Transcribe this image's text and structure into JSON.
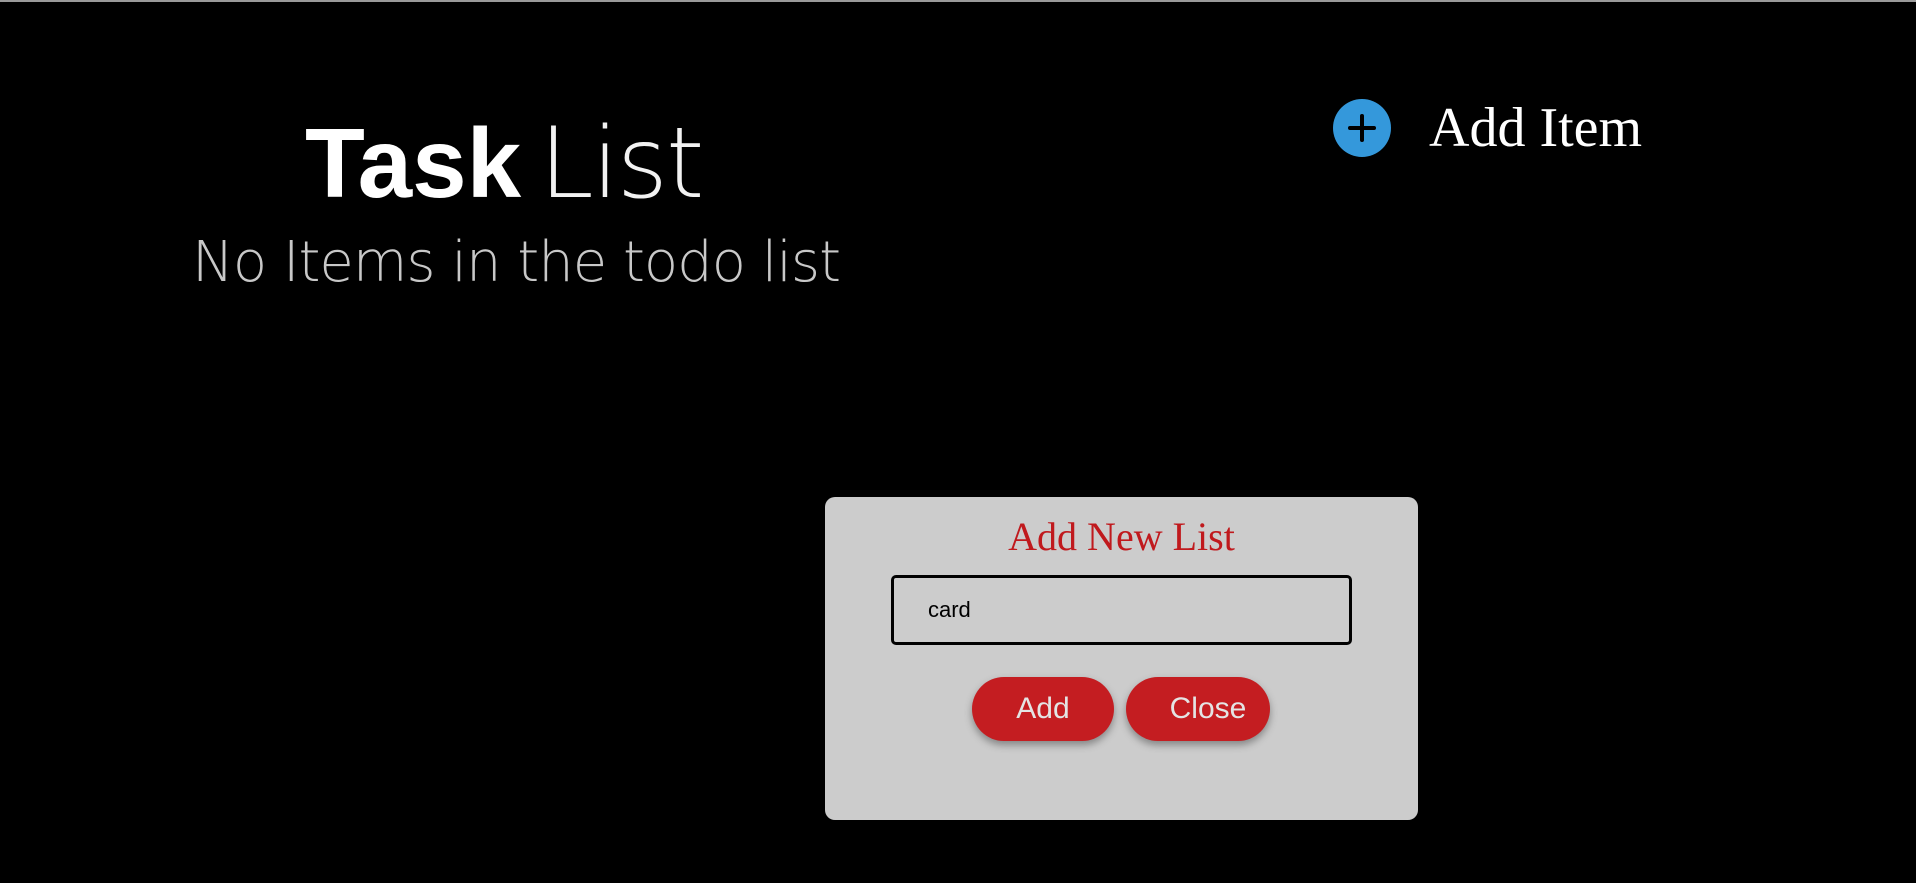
{
  "header": {
    "title_bold": "Task",
    "title_light": "List",
    "empty_message": "No Items in the todo list"
  },
  "add_item": {
    "icon": "plus-circle-icon",
    "label": "Add Item"
  },
  "modal": {
    "title": "Add New List",
    "input_value": "card",
    "add_label": "Add",
    "close_label": "Close"
  },
  "colors": {
    "background": "#000000",
    "accent_blue": "#3498db",
    "accent_red": "#c41d21",
    "modal_bg": "#cccccc"
  }
}
